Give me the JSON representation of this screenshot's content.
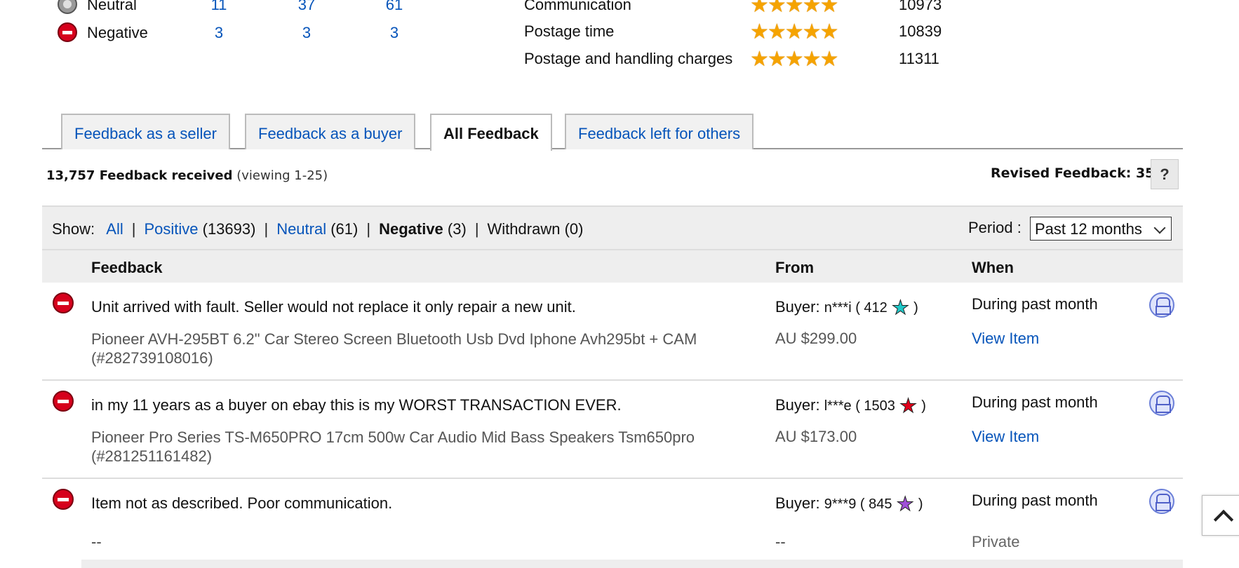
{
  "ratings": {
    "neutral": {
      "label": "Neutral",
      "c1": "11",
      "c2": "37",
      "c3": "61"
    },
    "negative": {
      "label": "Negative",
      "c1": "3",
      "c2": "3",
      "c3": "3"
    }
  },
  "dsr": [
    {
      "label": "Communication",
      "count": "10973"
    },
    {
      "label": "Postage time",
      "count": "10839"
    },
    {
      "label": "Postage and handling charges",
      "count": "11311"
    }
  ],
  "stars_glyph": "★★★★★",
  "tabs": [
    {
      "label": "Feedback as a seller"
    },
    {
      "label": "Feedback as a buyer"
    },
    {
      "label": "All Feedback"
    },
    {
      "label": "Feedback left for others"
    }
  ],
  "summary": {
    "received": "13,757 Feedback received",
    "viewing": "(viewing 1-25)"
  },
  "revised": "Revised Feedback: 35",
  "help": "?",
  "filter": {
    "show": "Show:",
    "all": "All",
    "positive": "Positive",
    "positive_count": "(13693)",
    "neutral": "Neutral",
    "neutral_count": "(61)",
    "negative": "Negative",
    "negative_count": "(3)",
    "withdrawn": "Withdrawn",
    "withdrawn_count": "(0)",
    "sep": "|",
    "period_label": "Period :",
    "period_value": "Past 12 months"
  },
  "columns": {
    "feedback": "Feedback",
    "from": "From",
    "when": "When"
  },
  "rows": [
    {
      "comment": "Unit arrived with fault. Seller would not replace it only repair a new unit.",
      "item": "Pioneer AVH-295BT 6.2\" Car Stereo Screen Bluetooth Usb Dvd Iphone Avh295bt + CAM (#282739108016)",
      "buyer_prefix": "Buyer:",
      "handle": "n***i ( 412",
      "close": ")",
      "star_color": "#1fc8c8",
      "price": "AU $299.00",
      "when": "During past month",
      "view": "View Item"
    },
    {
      "comment": "in my 11 years as a buyer on ebay this is my WORST TRANSACTION EVER.",
      "item": "Pioneer Pro Series TS-M650PRO 17cm 500w Car Audio Mid Bass Speakers Tsm650pro (#281251161482)",
      "buyer_prefix": "Buyer:",
      "handle": "l***e ( 1503",
      "close": ")",
      "star_color": "#e0001b",
      "price": "AU $173.00",
      "when": "During past month",
      "view": "View Item"
    },
    {
      "comment": "Item not as described. Poor communication.",
      "buyer_prefix": "Buyer:",
      "handle": "9***9 ( 845",
      "close": ")",
      "star_color": "#a050d8",
      "when": "During past month",
      "dash_item": "--",
      "dash_price": "--",
      "private": "Private"
    }
  ],
  "star_glyph": "★"
}
